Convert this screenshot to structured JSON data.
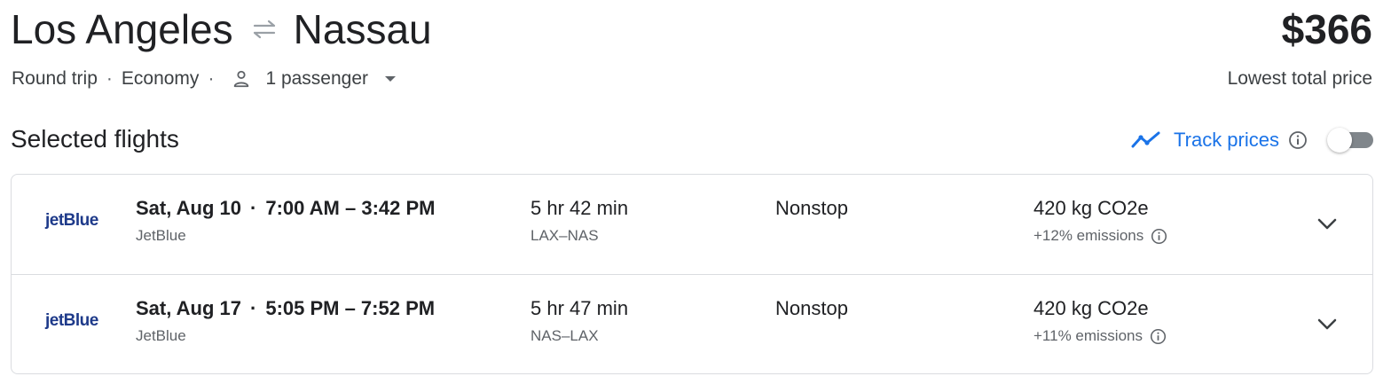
{
  "header": {
    "origin": "Los Angeles",
    "destination": "Nassau",
    "swap_icon": "swap-arrows-icon",
    "price": "$366",
    "price_caption": "Lowest total price",
    "trip_type": "Round trip",
    "cabin": "Economy",
    "passengers": "1 passenger",
    "separator": "·"
  },
  "section": {
    "title": "Selected flights",
    "track_prices_label": "Track prices",
    "track_prices_enabled": false
  },
  "flights": [
    {
      "airline_logo_text": "jetBlue",
      "date": "Sat, Aug 10",
      "time_range": "7:00 AM – 3:42 PM",
      "airline": "JetBlue",
      "duration": "5 hr 42 min",
      "route": "LAX–NAS",
      "stops": "Nonstop",
      "co2": "420 kg CO2e",
      "emissions": "+12% emissions"
    },
    {
      "airline_logo_text": "jetBlue",
      "date": "Sat, Aug 17",
      "time_range": "5:05 PM – 7:52 PM",
      "airline": "JetBlue",
      "duration": "5 hr 47 min",
      "route": "NAS–LAX",
      "stops": "Nonstop",
      "co2": "420 kg CO2e",
      "emissions": "+11% emissions"
    }
  ],
  "colors": {
    "accent": "#1a73e8",
    "text_primary": "#202124",
    "text_secondary": "#5f6368",
    "border": "#dadce0",
    "jetblue": "#1e3a8a"
  }
}
